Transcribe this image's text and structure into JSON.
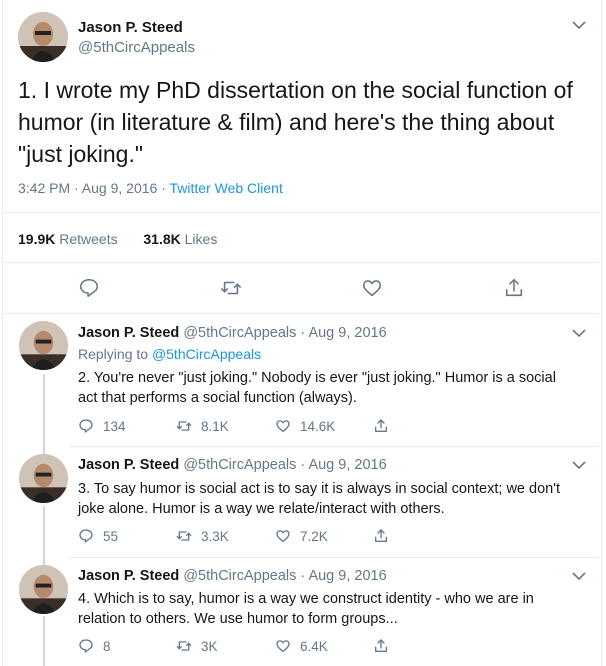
{
  "main": {
    "name": "Jason P. Steed",
    "handle": "@5thCircAppeals",
    "text": "1. I wrote my PhD dissertation on the social function of humor (in literature & film) and here's the thing about \"just joking.\"",
    "timestamp": "3:42 PM · Aug 9, 2016 · ",
    "client": "Twitter Web Client",
    "retweets_count": "19.9K",
    "retweets_label": "Retweets",
    "likes_count": "31.8K",
    "likes_label": "Likes",
    "icons": [
      "reply-icon",
      "retweet-icon",
      "like-icon",
      "share-icon"
    ]
  },
  "replies": [
    {
      "name": "Jason P. Steed",
      "meta": "@5thCircAppeals · Aug 9, 2016",
      "replying_prefix": "Replying to ",
      "replying_to": "@5thCircAppeals",
      "text": "2. You're never \"just joking.\" Nobody is ever \"just joking.\" Humor is a social act that performs a social function (always).",
      "replies": "134",
      "retweets": "8.1K",
      "likes": "14.6K"
    },
    {
      "name": "Jason P. Steed",
      "meta": "@5thCircAppeals · Aug 9, 2016",
      "text": "3. To say humor is social act is to say it is always in social context; we don't joke alone. Humor is a way we relate/interact with others.",
      "replies": "55",
      "retweets": "3.3K",
      "likes": "7.2K"
    },
    {
      "name": "Jason P. Steed",
      "meta": "@5thCircAppeals · Aug 9, 2016",
      "text": "4. Which is to say, humor is a way we construct identity - who we are in relation to others. We use humor to form groups...",
      "replies": "8",
      "retweets": "3K",
      "likes": "6.4K"
    }
  ],
  "colors": {
    "text": "#14171a",
    "muted": "#657786",
    "link": "#1b95e0",
    "border": "#e6ecf0",
    "thread_line": "#ccd6dd"
  }
}
